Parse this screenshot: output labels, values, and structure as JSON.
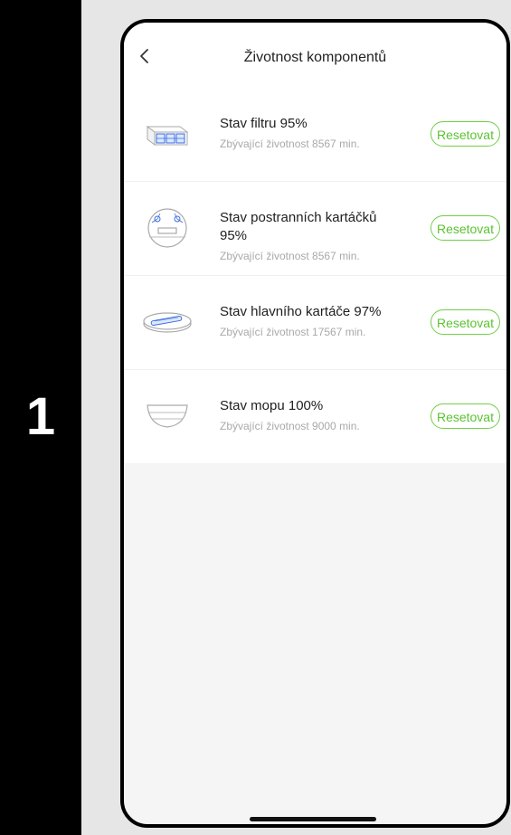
{
  "step": {
    "number": "1"
  },
  "nav": {
    "title": "Životnost komponentů",
    "back_icon": "chevron-left-icon"
  },
  "items": [
    {
      "title": "Stav filtru 95%",
      "subtitle": "Zbývající životnost 8567 min.",
      "button": "Resetovat",
      "icon": "filter-icon"
    },
    {
      "title": "Stav postranních kartáčků 95%",
      "subtitle": "Zbývající životnost 8567 min.",
      "button": "Resetovat",
      "icon": "side-brush-icon"
    },
    {
      "title": "Stav hlavního kartáče 97%",
      "subtitle": "Zbývající životnost 17567 min.",
      "button": "Resetovat",
      "icon": "main-brush-icon"
    },
    {
      "title": "Stav mopu 100%",
      "subtitle": "Zbývající životnost 9000 min.",
      "button": "Resetovat",
      "icon": "mop-icon"
    }
  ],
  "colors": {
    "accent": "#5cc233",
    "side_panel": "#000000",
    "background": "#e6e6e6"
  }
}
